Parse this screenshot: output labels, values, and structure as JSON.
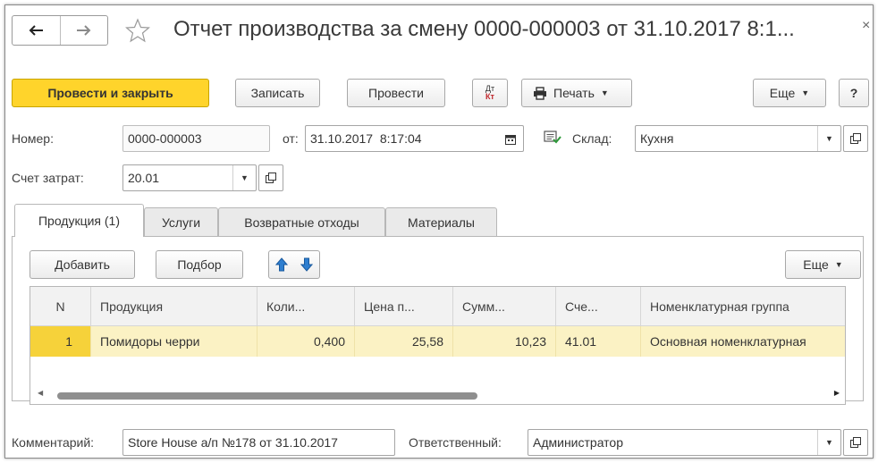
{
  "window": {
    "title": "Отчет производства за смену 0000-000003 от 31.10.2017 8:1...",
    "close": "×"
  },
  "toolbar": {
    "post_close": "Провести и закрыть",
    "save": "Записать",
    "post": "Провести",
    "dtkt_top": "Дт",
    "dtkt_bottom": "Кт",
    "print": "Печать",
    "more": "Еще",
    "help": "?"
  },
  "form": {
    "number_label": "Номер:",
    "number_value": "0000-000003",
    "date_label": "от:",
    "date_value": "31.10.2017  8:17:04",
    "warehouse_label": "Склад:",
    "warehouse_value": "Кухня",
    "cost_account_label": "Счет затрат:",
    "cost_account_value": "20.01",
    "comment_label": "Комментарий:",
    "comment_value": "Store House а/п №178 от 31.10.2017",
    "responsible_label": "Ответственный:",
    "responsible_value": "Администратор"
  },
  "tabs": [
    {
      "label": "Продукция (1)",
      "active": true
    },
    {
      "label": "Услуги",
      "active": false
    },
    {
      "label": "Возвратные отходы",
      "active": false
    },
    {
      "label": "Материалы",
      "active": false
    }
  ],
  "table_toolbar": {
    "add": "Добавить",
    "pick": "Подбор",
    "more": "Еще"
  },
  "table": {
    "columns": [
      "N",
      "Продукция",
      "Коли...",
      "Цена п...",
      "Сумм...",
      "Сче...",
      "Номенклатурная группа"
    ],
    "rows": [
      [
        "1",
        "Помидоры черри",
        "0,400",
        "25,58",
        "10,23",
        "41.01",
        "Основная номенклатурная"
      ]
    ]
  },
  "colors": {
    "primary_button": "#ffd42b",
    "selected_row": "#fbf2c4",
    "selected_cell": "#f6d23a",
    "arrow_blue": "#2f7fd0"
  }
}
